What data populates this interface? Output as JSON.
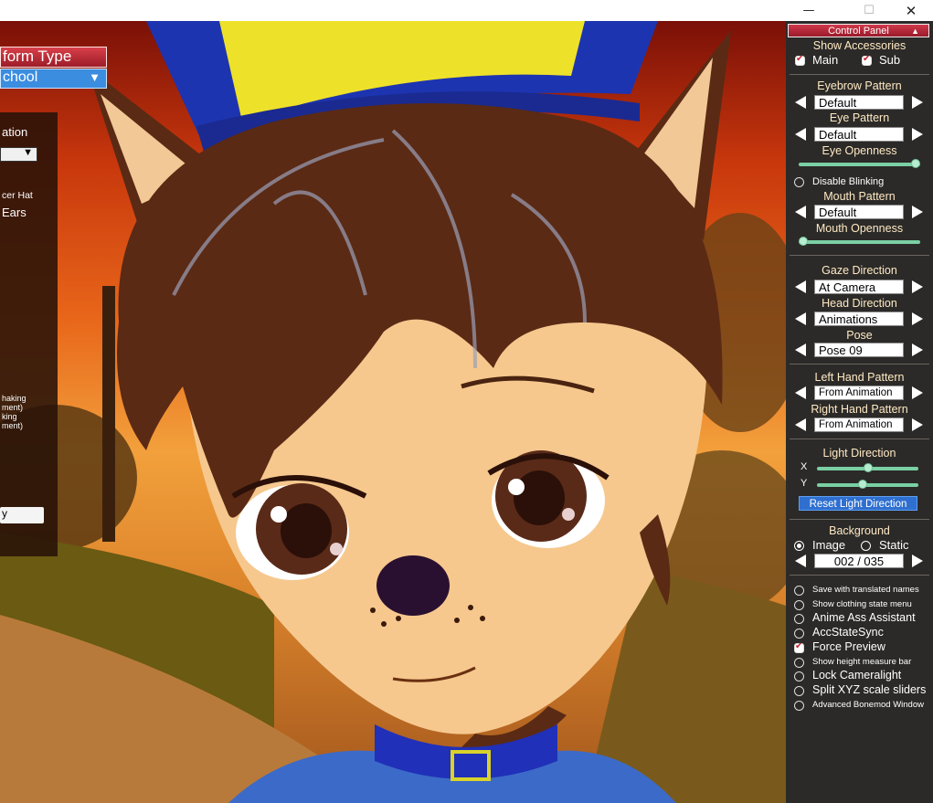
{
  "window": {
    "minimize_glyph": "—",
    "maximize_glyph": "☐",
    "close_glyph": "✕"
  },
  "left_panel": {
    "header": "form Type",
    "select_value": "chool",
    "section_label": "ation",
    "item_1": "cer Hat",
    "item_2": "Ears",
    "note_1": "haking",
    "note_2": "ment)",
    "note_3": "king",
    "note_4": "ment)",
    "button_label": "y"
  },
  "control_panel": {
    "title": "Control Panel",
    "show_accessories": {
      "label": "Show Accessories",
      "main_label": "Main",
      "main_checked": true,
      "sub_label": "Sub",
      "sub_checked": true
    },
    "eyebrow_pattern": {
      "label": "Eyebrow Pattern",
      "value": "Default"
    },
    "eye_pattern": {
      "label": "Eye Pattern",
      "value": "Default"
    },
    "eye_openness": {
      "label": "Eye Openness",
      "value": 1.0
    },
    "disable_blinking": {
      "label": "Disable Blinking",
      "checked": false
    },
    "mouth_pattern": {
      "label": "Mouth Pattern",
      "value": "Default"
    },
    "mouth_openness": {
      "label": "Mouth Openness",
      "value": 0.0
    },
    "gaze_direction": {
      "label": "Gaze Direction",
      "value": "At Camera"
    },
    "head_direction": {
      "label": "Head Direction",
      "value": "Animations"
    },
    "pose": {
      "label": "Pose",
      "value": "Pose 09"
    },
    "left_hand_pattern": {
      "label": "Left Hand Pattern",
      "value": "From Animation"
    },
    "right_hand_pattern": {
      "label": "Right Hand Pattern",
      "value": "From Animation"
    },
    "light_direction": {
      "label": "Light Direction",
      "x_label": "X",
      "x_value": 0.5,
      "y_label": "Y",
      "y_value": 0.45,
      "reset_label": "Reset Light Direction"
    },
    "background": {
      "label": "Background",
      "image_label": "Image",
      "static_label": "Static",
      "selected": "Image",
      "counter": "002 / 035"
    },
    "options": [
      {
        "label": "Save with translated names",
        "checked": false,
        "small": true
      },
      {
        "label": "Show clothing state menu",
        "checked": false,
        "small": true
      },
      {
        "label": "Anime Ass Assistant",
        "checked": false,
        "small": false
      },
      {
        "label": "AccStateSync",
        "checked": false,
        "small": false
      },
      {
        "label": "Force Preview",
        "checked": true,
        "small": false
      },
      {
        "label": "Show height measure bar",
        "checked": false,
        "small": true
      },
      {
        "label": "Lock Cameralight",
        "checked": false,
        "small": false
      },
      {
        "label": "Split XYZ scale sliders",
        "checked": false,
        "small": false
      },
      {
        "label": "Advanced Bonemod Window",
        "checked": false,
        "small": true
      }
    ]
  },
  "colors": {
    "panel_bg": "#2b2a28",
    "panel_title": "#c0283a",
    "label_text": "#ffe9c4",
    "slider": "#7ad0a4",
    "reset_button": "#2e6fd0",
    "left_select": "#3b8de0"
  }
}
